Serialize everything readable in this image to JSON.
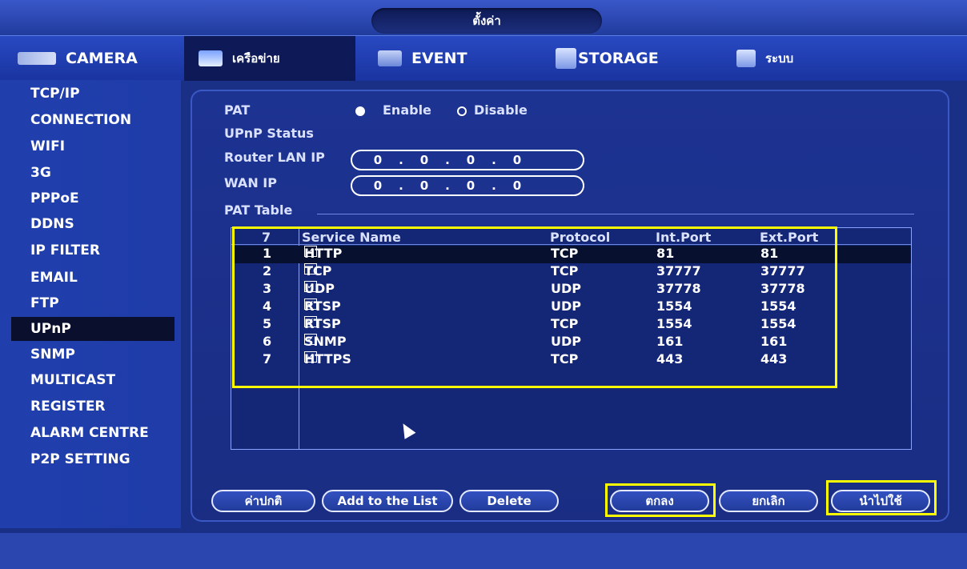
{
  "window": {
    "title": "ตั้งค่า"
  },
  "tabs": [
    {
      "label": "CAMERA",
      "icon": "camera-icon"
    },
    {
      "label": "เครือข่าย",
      "icon": "network-icon"
    },
    {
      "label": "EVENT",
      "icon": "event-icon"
    },
    {
      "label": "STORAGE",
      "icon": "storage-icon"
    },
    {
      "label": "ระบบ",
      "icon": "system-icon"
    }
  ],
  "sidebar": {
    "items": [
      {
        "label": "TCP/IP"
      },
      {
        "label": "CONNECTION"
      },
      {
        "label": "WIFI"
      },
      {
        "label": "3G"
      },
      {
        "label": "PPPoE"
      },
      {
        "label": "DDNS"
      },
      {
        "label": "IP FILTER"
      },
      {
        "label": "EMAIL"
      },
      {
        "label": "FTP"
      },
      {
        "label": "UPnP"
      },
      {
        "label": "SNMP"
      },
      {
        "label": "MULTICAST"
      },
      {
        "label": "REGISTER"
      },
      {
        "label": "ALARM CENTRE"
      },
      {
        "label": "P2P SETTING"
      }
    ],
    "selected": "UPnP"
  },
  "form": {
    "pat_label": "PAT",
    "enable_label": "Enable",
    "disable_label": "Disable",
    "pat_value": "Enable",
    "upnp_status_label": "UPnP Status",
    "router_lan_ip_label": "Router LAN IP",
    "router_lan_ip": [
      "0",
      "0",
      "0",
      "0"
    ],
    "wan_ip_label": "WAN IP",
    "wan_ip": [
      "0",
      "0",
      "0",
      "0"
    ],
    "pat_table_label": "PAT Table"
  },
  "table": {
    "headers": {
      "index": "7",
      "service": "Service Name",
      "protocol": "Protocol",
      "int_port": "Int.Port",
      "ext_port": "Ext.Port"
    },
    "rows": [
      {
        "num": "1",
        "checked": true,
        "service": "HTTP",
        "protocol": "TCP",
        "int_port": "81",
        "ext_port": "81"
      },
      {
        "num": "2",
        "checked": true,
        "service": "TCP",
        "protocol": "TCP",
        "int_port": "37777",
        "ext_port": "37777"
      },
      {
        "num": "3",
        "checked": true,
        "service": "UDP",
        "protocol": "UDP",
        "int_port": "37778",
        "ext_port": "37778"
      },
      {
        "num": "4",
        "checked": true,
        "service": "RTSP",
        "protocol": "UDP",
        "int_port": "1554",
        "ext_port": "1554"
      },
      {
        "num": "5",
        "checked": true,
        "service": "RTSP",
        "protocol": "TCP",
        "int_port": "1554",
        "ext_port": "1554"
      },
      {
        "num": "6",
        "checked": true,
        "service": "SNMP",
        "protocol": "UDP",
        "int_port": "161",
        "ext_port": "161"
      },
      {
        "num": "7",
        "checked": true,
        "service": "HTTPS",
        "protocol": "TCP",
        "int_port": "443",
        "ext_port": "443"
      }
    ],
    "selected_row": "1"
  },
  "buttons": {
    "default": "ค่าปกติ",
    "add": "Add to the List",
    "delete": "Delete",
    "ok": "ตกลง",
    "cancel": "ยกเลิก",
    "apply": "นำไปใช้"
  },
  "colors": {
    "highlight": "#ffff00",
    "background": "#1a2f86",
    "selected": "#0a0f2e"
  }
}
